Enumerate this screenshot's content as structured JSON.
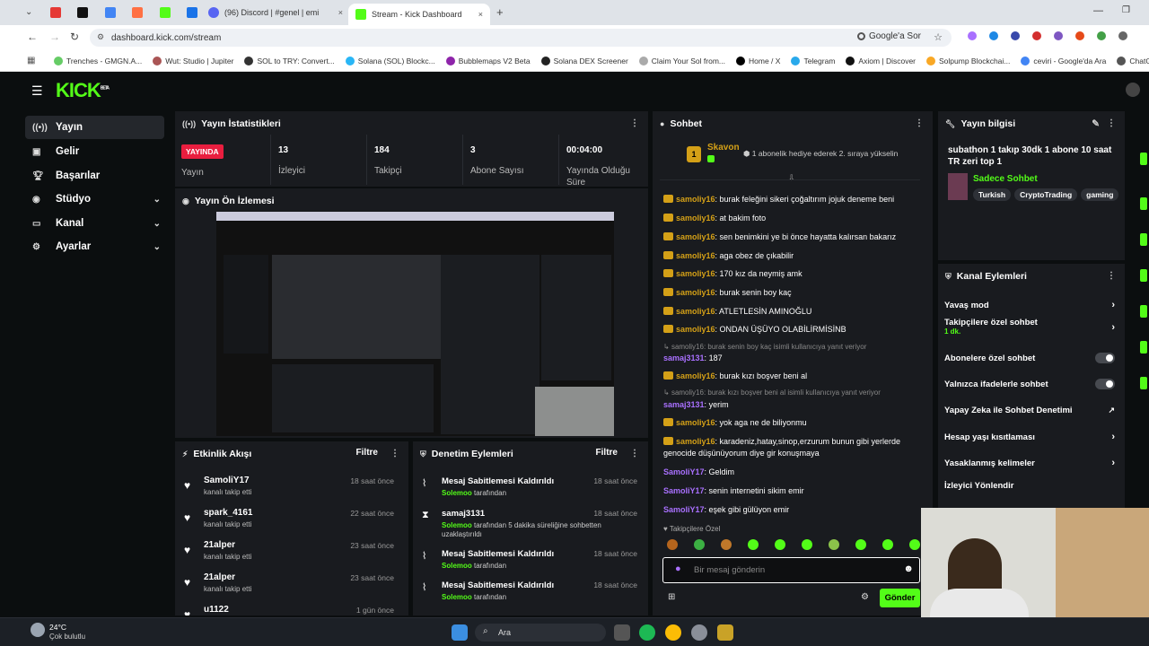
{
  "browser": {
    "tabs": [
      {
        "label": ""
      },
      {
        "label": ""
      },
      {
        "label": "(96) Discord | #genel | emi"
      },
      {
        "label": "Stream - Kick Dashboard"
      }
    ],
    "url": "dashboard.kick.com/stream",
    "google_btn": "Google'a Sor",
    "bookmarks": [
      "Trenches - GMGN.A...",
      "Wut: Studio | Jupiter",
      "SOL to TRY: Convert...",
      "Solana (SOL) Blockc...",
      "Bubblemaps V2 Beta",
      "Solana DEX Screener",
      "Claim Your Sol from...",
      "Home / X",
      "Telegram",
      "Axiom | Discover",
      "Solpump Blockchai...",
      "ceviri - Google'da Ara",
      "ChatGPT"
    ]
  },
  "logo": "KICK",
  "logo_badge": "BETA",
  "sidebar": [
    {
      "label": "Yayın",
      "icon": "broadcast-icon",
      "chev": ""
    },
    {
      "label": "Gelir",
      "icon": "money-icon",
      "chev": ""
    },
    {
      "label": "Başarılar",
      "icon": "trophy-icon",
      "chev": ""
    },
    {
      "label": "Stüdyo",
      "icon": "studio-icon",
      "chev": "⌄"
    },
    {
      "label": "Kanal",
      "icon": "channel-icon",
      "chev": "⌄"
    },
    {
      "label": "Ayarlar",
      "icon": "gear-icon",
      "chev": "⌄"
    }
  ],
  "stats": {
    "title": "Yayın İstatistikleri",
    "live_badge": "YAYINDA",
    "live_label": "Yayın",
    "items": [
      {
        "value": "13",
        "label": "İzleyici"
      },
      {
        "value": "184",
        "label": "Takipçi"
      },
      {
        "value": "3",
        "label": "Abone Sayısı"
      },
      {
        "value": "00:04:00",
        "label": "Yayında Olduğu Süre"
      }
    ]
  },
  "preview": {
    "title": "Yayın Ön İzlemesi"
  },
  "activity": {
    "title": "Etkinlik Akışı",
    "filter": "Filtre",
    "rows": [
      {
        "name": "SamoliY17",
        "sub": "kanalı takip etti",
        "time": "18 saat önce"
      },
      {
        "name": "spark_4161",
        "sub": "kanalı takip etti",
        "time": "22 saat önce"
      },
      {
        "name": "21alper",
        "sub": "kanalı takip etti",
        "time": "23 saat önce"
      },
      {
        "name": "21alper",
        "sub": "kanalı takip etti",
        "time": "23 saat önce"
      },
      {
        "name": "u1122",
        "sub": "",
        "time": "1 gün önce"
      }
    ]
  },
  "moderation": {
    "title": "Denetim Eylemleri",
    "filter": "Filtre",
    "rows": [
      {
        "name": "Mesaj Sabitlemesi Kaldırıldı",
        "actor": "Solemoo",
        "sub": " tarafından",
        "time": "18 saat önce"
      },
      {
        "name": "samaj3131",
        "actor": "Solemoo",
        "sub": " tarafından 5 dakika süreliğine sohbetten uzaklaştırıldı",
        "time": "18 saat önce"
      },
      {
        "name": "Mesaj Sabitlemesi Kaldırıldı",
        "actor": "Solemoo",
        "sub": " tarafından",
        "time": "18 saat önce"
      },
      {
        "name": "Mesaj Sabitlemesi Kaldırıldı",
        "actor": "Solemoo",
        "sub": " tarafından",
        "time": "18 saat önce"
      }
    ]
  },
  "chat": {
    "title": "Sohbet",
    "pinned_user": "Skavon",
    "pinned_rank": "1",
    "pinned_text": "1 abonelik hediye ederek 2. sıraya yükselin",
    "messages": [
      {
        "user": "samoliy16",
        "text": "burak feleğini sikeri çoğaltırım jojuk deneme beni",
        "color": "#d4a017"
      },
      {
        "user": "samoliy16",
        "text": "at bakim foto",
        "color": "#d4a017"
      },
      {
        "user": "samoliy16",
        "text": "sen benimkini ye bi önce hayatta kalırsan bakarız",
        "color": "#d4a017"
      },
      {
        "user": "samoliy16",
        "text": "aga obez de çıkabilir",
        "color": "#d4a017"
      },
      {
        "user": "samoliy16",
        "text": "170 kız da neymiş amk",
        "color": "#d4a017"
      },
      {
        "user": "samoliy16",
        "text": "burak senin boy kaç",
        "color": "#d4a017"
      },
      {
        "user": "samoliy16",
        "text": "ATLETLESİN AMINOĞLU",
        "color": "#d4a017"
      },
      {
        "user": "samoliy16",
        "text": "ONDAN ÜŞÜYO OLABİLİRMİSİNB",
        "color": "#d4a017"
      }
    ],
    "reply1": "samoliy16: burak senin boy kaç isimli kullanıcıya yanıt veriyor",
    "msg_r1_user": "samaj3131",
    "msg_r1_text": "187",
    "msg_a_user": "samoliy16",
    "msg_a_text": "burak kızı boşver beni al",
    "reply2": "samoliy16: burak kızı boşver beni al isimli kullanıcıya yanıt veriyor",
    "msg_r2_user": "samaj3131",
    "msg_r2_text": "yerim",
    "msg_b_user": "samoliy16",
    "msg_b_text": "yok aga ne de biliyonmu",
    "msg_c_user": "samoliy16",
    "msg_c_text": "karadeniz,hatay,sinop,erzurum bunun gibi yerlerde genocide düşünüyorum diye gir konuşmaya",
    "msg_d_user": "SamoliY17",
    "msg_d_text": "Geldim",
    "msg_e_user": "SamoliY17",
    "msg_e_text": "senin internetini sikim emir",
    "msg_f_user": "SamoliY17",
    "msg_f_text": "eşek gibi gülüyon emir",
    "followers_only": "Takipçilere Özel",
    "input_placeholder": "Bir mesaj gönderin",
    "send": "Gönder"
  },
  "info": {
    "title": "Yayın bilgisi",
    "stream_title": "subathon 1 takıp 30dk 1 abone 10 saat TR zeri top 1",
    "category": "Sadece Sohbet",
    "tags": [
      "Turkish",
      "CryptoTrading",
      "gaming"
    ]
  },
  "channel_actions": {
    "title": "Kanal Eylemleri",
    "items": [
      {
        "label": "Yavaş mod",
        "sub": "",
        "ctrl": "arrow"
      },
      {
        "label": "Takipçilere özel sohbet",
        "sub": "1 dk.",
        "ctrl": "arrow"
      },
      {
        "label": "Abonelere özel sohbet",
        "sub": "",
        "ctrl": "toggle"
      },
      {
        "label": "Yalnızca ifadelerle sohbet",
        "sub": "",
        "ctrl": "toggle"
      },
      {
        "label": "Yapay Zeka ile Sohbet Denetimi",
        "sub": "",
        "ctrl": "ext"
      },
      {
        "label": "Hesap yaşı kısıtlaması",
        "sub": "",
        "ctrl": "arrow"
      },
      {
        "label": "Yasaklanmış kelimeler",
        "sub": "",
        "ctrl": "arrow"
      },
      {
        "label": "İzleyici Yönlendir",
        "sub": "",
        "ctrl": "none"
      }
    ]
  },
  "taskbar": {
    "weather_temp": "24°C",
    "weather_desc": "Çok bulutlu",
    "search": "Ara"
  },
  "colors": {
    "accent": "#53fc18",
    "panel": "#191b1f",
    "live": "#e91e3f",
    "gold": "#d4a017",
    "purple": "#a970ff"
  }
}
